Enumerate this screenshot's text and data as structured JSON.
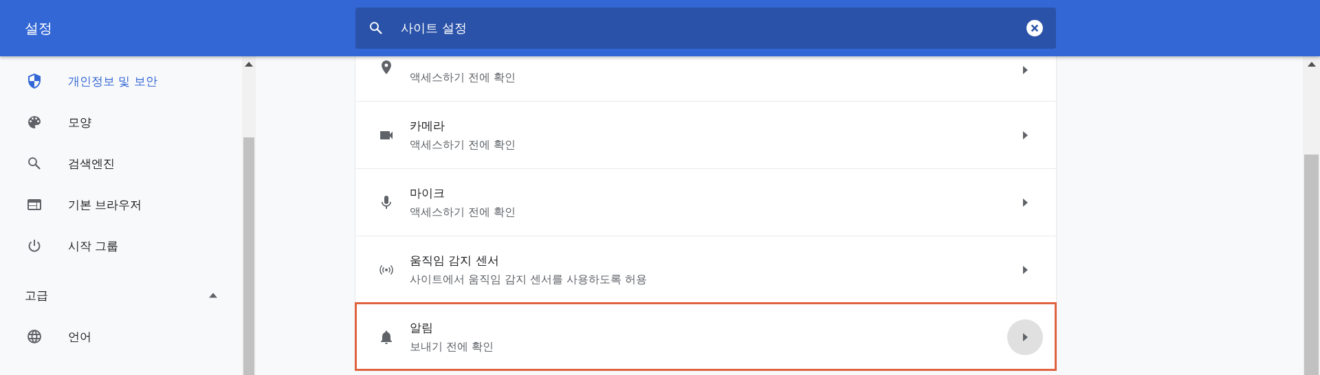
{
  "header": {
    "title": "설정",
    "search": {
      "value": "사이트 설정"
    }
  },
  "sidebar": {
    "items": [
      {
        "label": "개인정보 및 보안",
        "selected": true
      },
      {
        "label": "모양",
        "selected": false
      },
      {
        "label": "검색엔진",
        "selected": false
      },
      {
        "label": "기본 브라우저",
        "selected": false
      },
      {
        "label": "시작 그룹",
        "selected": false
      }
    ],
    "advanced": {
      "label": "고급",
      "expanded": true,
      "items": [
        {
          "label": "언어",
          "selected": false
        }
      ]
    }
  },
  "permissions": [
    {
      "subtitle": "액세스하기 전에 확인",
      "hovered": false,
      "highlighted": false
    },
    {
      "title": "카메라",
      "subtitle": "액세스하기 전에 확인",
      "hovered": false,
      "highlighted": false
    },
    {
      "title": "마이크",
      "subtitle": "액세스하기 전에 확인",
      "hovered": false,
      "highlighted": false
    },
    {
      "title": "움직임 감지 센서",
      "subtitle": "사이트에서 움직임 감지 센서를 사용하도록 허용",
      "hovered": false,
      "highlighted": false
    },
    {
      "title": "알림",
      "subtitle": "보내기 전에 확인",
      "hovered": true,
      "highlighted": true
    }
  ]
}
